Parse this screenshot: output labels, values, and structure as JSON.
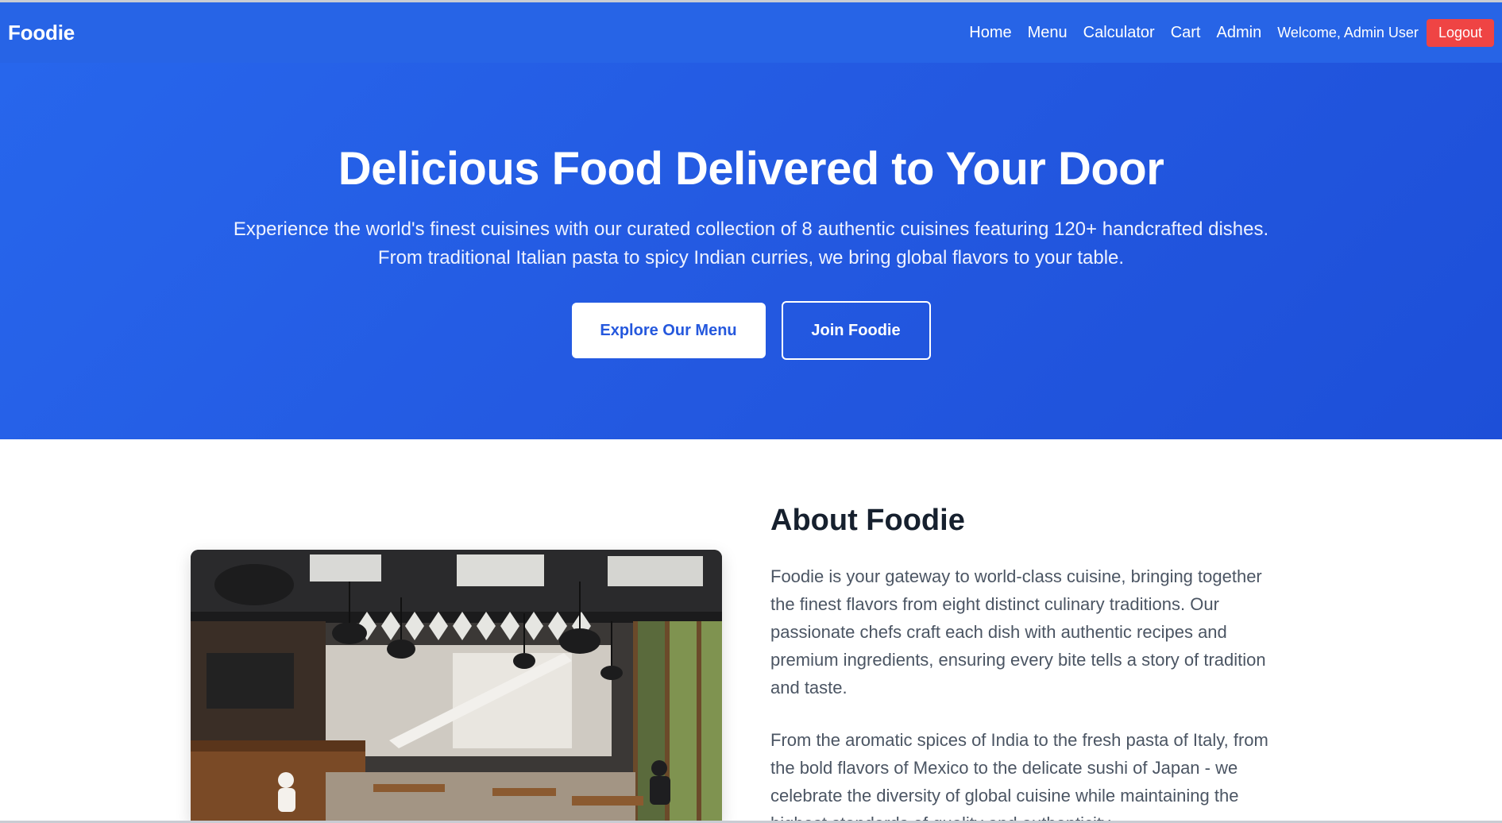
{
  "navbar": {
    "brand": "Foodie",
    "links": [
      "Home",
      "Menu",
      "Calculator",
      "Cart",
      "Admin"
    ],
    "welcome": "Welcome, Admin User",
    "logout_label": "Logout"
  },
  "hero": {
    "title": "Delicious Food Delivered to Your Door",
    "subtitle_line1": "Experience the world's finest cuisines with our curated collection of 8 authentic cuisines featuring 120+ handcrafted dishes.",
    "subtitle_line2": "From traditional Italian pasta to spicy Indian curries, we bring global flavors to your table.",
    "primary_button": "Explore Our Menu",
    "secondary_button": "Join Foodie"
  },
  "about": {
    "title": "About Foodie",
    "paragraph1": "Foodie is your gateway to world-class cuisine, bringing together the finest flavors from eight distinct culinary traditions. Our passionate chefs craft each dish with authentic recipes and premium ingredients, ensuring every bite tells a story of tradition and taste.",
    "paragraph2": "From the aromatic spices of India to the fresh pasta of Italy, from the bold flavors of Mexico to the delicate sushi of Japan - we celebrate the diversity of global cuisine while maintaining the highest standards of quality and authenticity."
  },
  "colors": {
    "primary": "#2764e6",
    "logout": "#ef4444",
    "heading": "#16202e",
    "body_text": "#4b5563"
  }
}
